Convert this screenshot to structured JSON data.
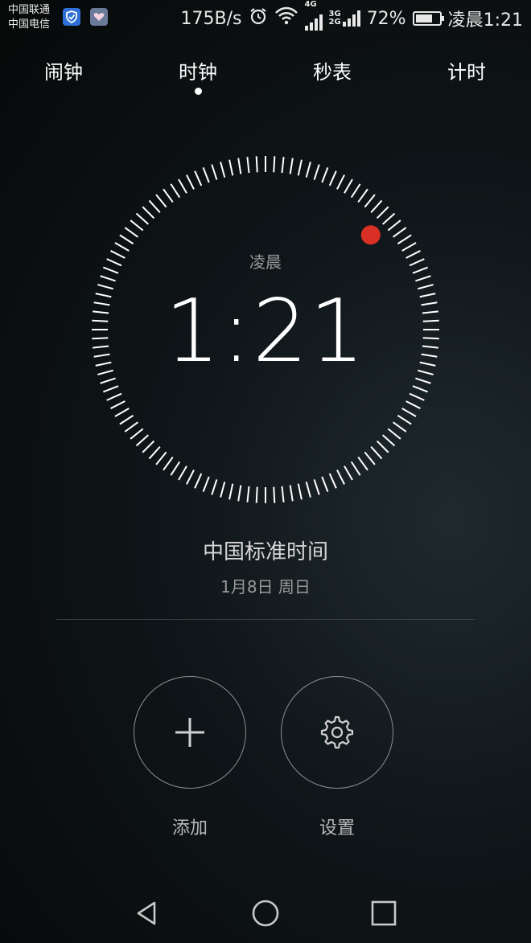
{
  "status_bar": {
    "carrier_1": "中国联通",
    "carrier_2": "中国电信",
    "net_speed": "175B/s",
    "net_4g": "4G",
    "net_3g": "3G",
    "net_2g": "2G",
    "battery_percent": "72%",
    "battery_level": 0.72,
    "time": "凌晨1:21",
    "icons": [
      "shield-app-icon",
      "health-app-icon",
      "alarm-icon",
      "wifi-icon",
      "signal-icon",
      "battery-icon"
    ]
  },
  "tabs": [
    {
      "label": "闹钟"
    },
    {
      "label": "时钟",
      "active": true
    },
    {
      "label": "秒表"
    },
    {
      "label": "计时"
    }
  ],
  "clock": {
    "period": "凌晨",
    "time": "1:21",
    "second_dot_color": "#d93025",
    "tick_count": 120
  },
  "timezone": {
    "name": "中国标准时间",
    "date": "1月8日 周日"
  },
  "actions": {
    "add_label": "添加",
    "settings_label": "设置"
  },
  "navigation": {
    "icons": [
      "back-icon",
      "home-icon",
      "recent-apps-icon"
    ]
  }
}
